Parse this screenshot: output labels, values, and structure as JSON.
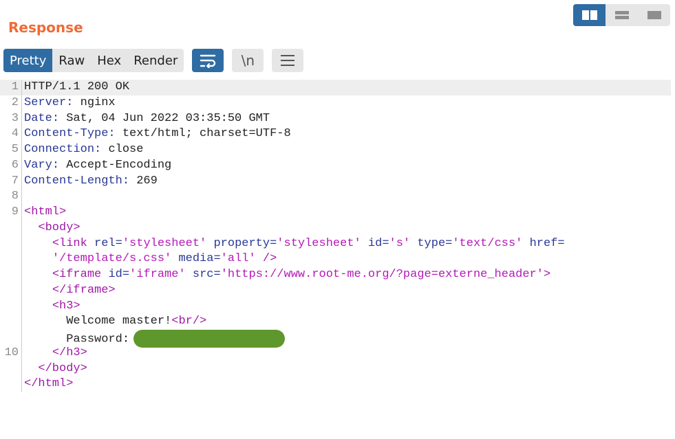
{
  "panel": {
    "title": "Response"
  },
  "layout_toggle": {
    "buttons": [
      {
        "name": "split-view-icon",
        "active": true
      },
      {
        "name": "horizontal-view-icon",
        "active": false
      },
      {
        "name": "single-view-icon",
        "active": false
      }
    ]
  },
  "tabs": {
    "pretty": "Pretty",
    "raw": "Raw",
    "hex": "Hex",
    "render": "Render",
    "newline_label": "\\n"
  },
  "colors": {
    "accent": "#2f6ca3",
    "title": "#ef6b36",
    "header_name": "#2a3896",
    "tag": "#a118a8",
    "attr_value": "#b51ab8",
    "redaction": "#5e972b"
  },
  "response": {
    "status_line": "HTTP/1.1 200 OK",
    "headers": [
      {
        "name": "Server",
        "sep": ": ",
        "value": "nginx"
      },
      {
        "name": "Date",
        "sep": ": ",
        "value": "Sat, 04 Jun 2022 03:35:50 GMT"
      },
      {
        "name": "Content-Type",
        "sep": ": ",
        "value": "text/html; charset=UTF-8"
      },
      {
        "name": "Connection",
        "sep": ": ",
        "value": "close"
      },
      {
        "name": "Vary",
        "sep": ": ",
        "value": "Accept-Encoding"
      },
      {
        "name": "Content-Length",
        "sep": ": ",
        "value": "269"
      }
    ],
    "line_numbers": [
      "1",
      "2",
      "3",
      "4",
      "5",
      "6",
      "7",
      "8",
      "9",
      "10"
    ],
    "body": {
      "html_open": "<html>",
      "body_open": "<body>",
      "link_tag": "<link",
      "link_rel_attr": "rel=",
      "link_rel_val": "'stylesheet'",
      "link_prop_attr": "property=",
      "link_prop_val": "'stylesheet'",
      "link_id_attr": "id=",
      "link_id_val": "'s'",
      "link_type_attr": "type=",
      "link_type_val": "'text/css'",
      "link_href_attr": "href=",
      "link_href_val": "'/template/s.css'",
      "link_media_attr": "media=",
      "link_media_val": "'all'",
      "link_close": "/>",
      "iframe_tag": "<iframe",
      "iframe_id_attr": "id=",
      "iframe_id_val": "'iframe'",
      "iframe_src_attr": "src=",
      "iframe_src_val": "'https://www.root-me.org/?page=externe_header'",
      "iframe_gt": ">",
      "iframe_close": "</iframe>",
      "h3_open": "<h3>",
      "welcome_text": "Welcome master!",
      "br_tag": "<br/>",
      "password_label": "Password:",
      "h3_close": "</h3>",
      "body_close": "</body>",
      "html_close": "</html>"
    }
  }
}
